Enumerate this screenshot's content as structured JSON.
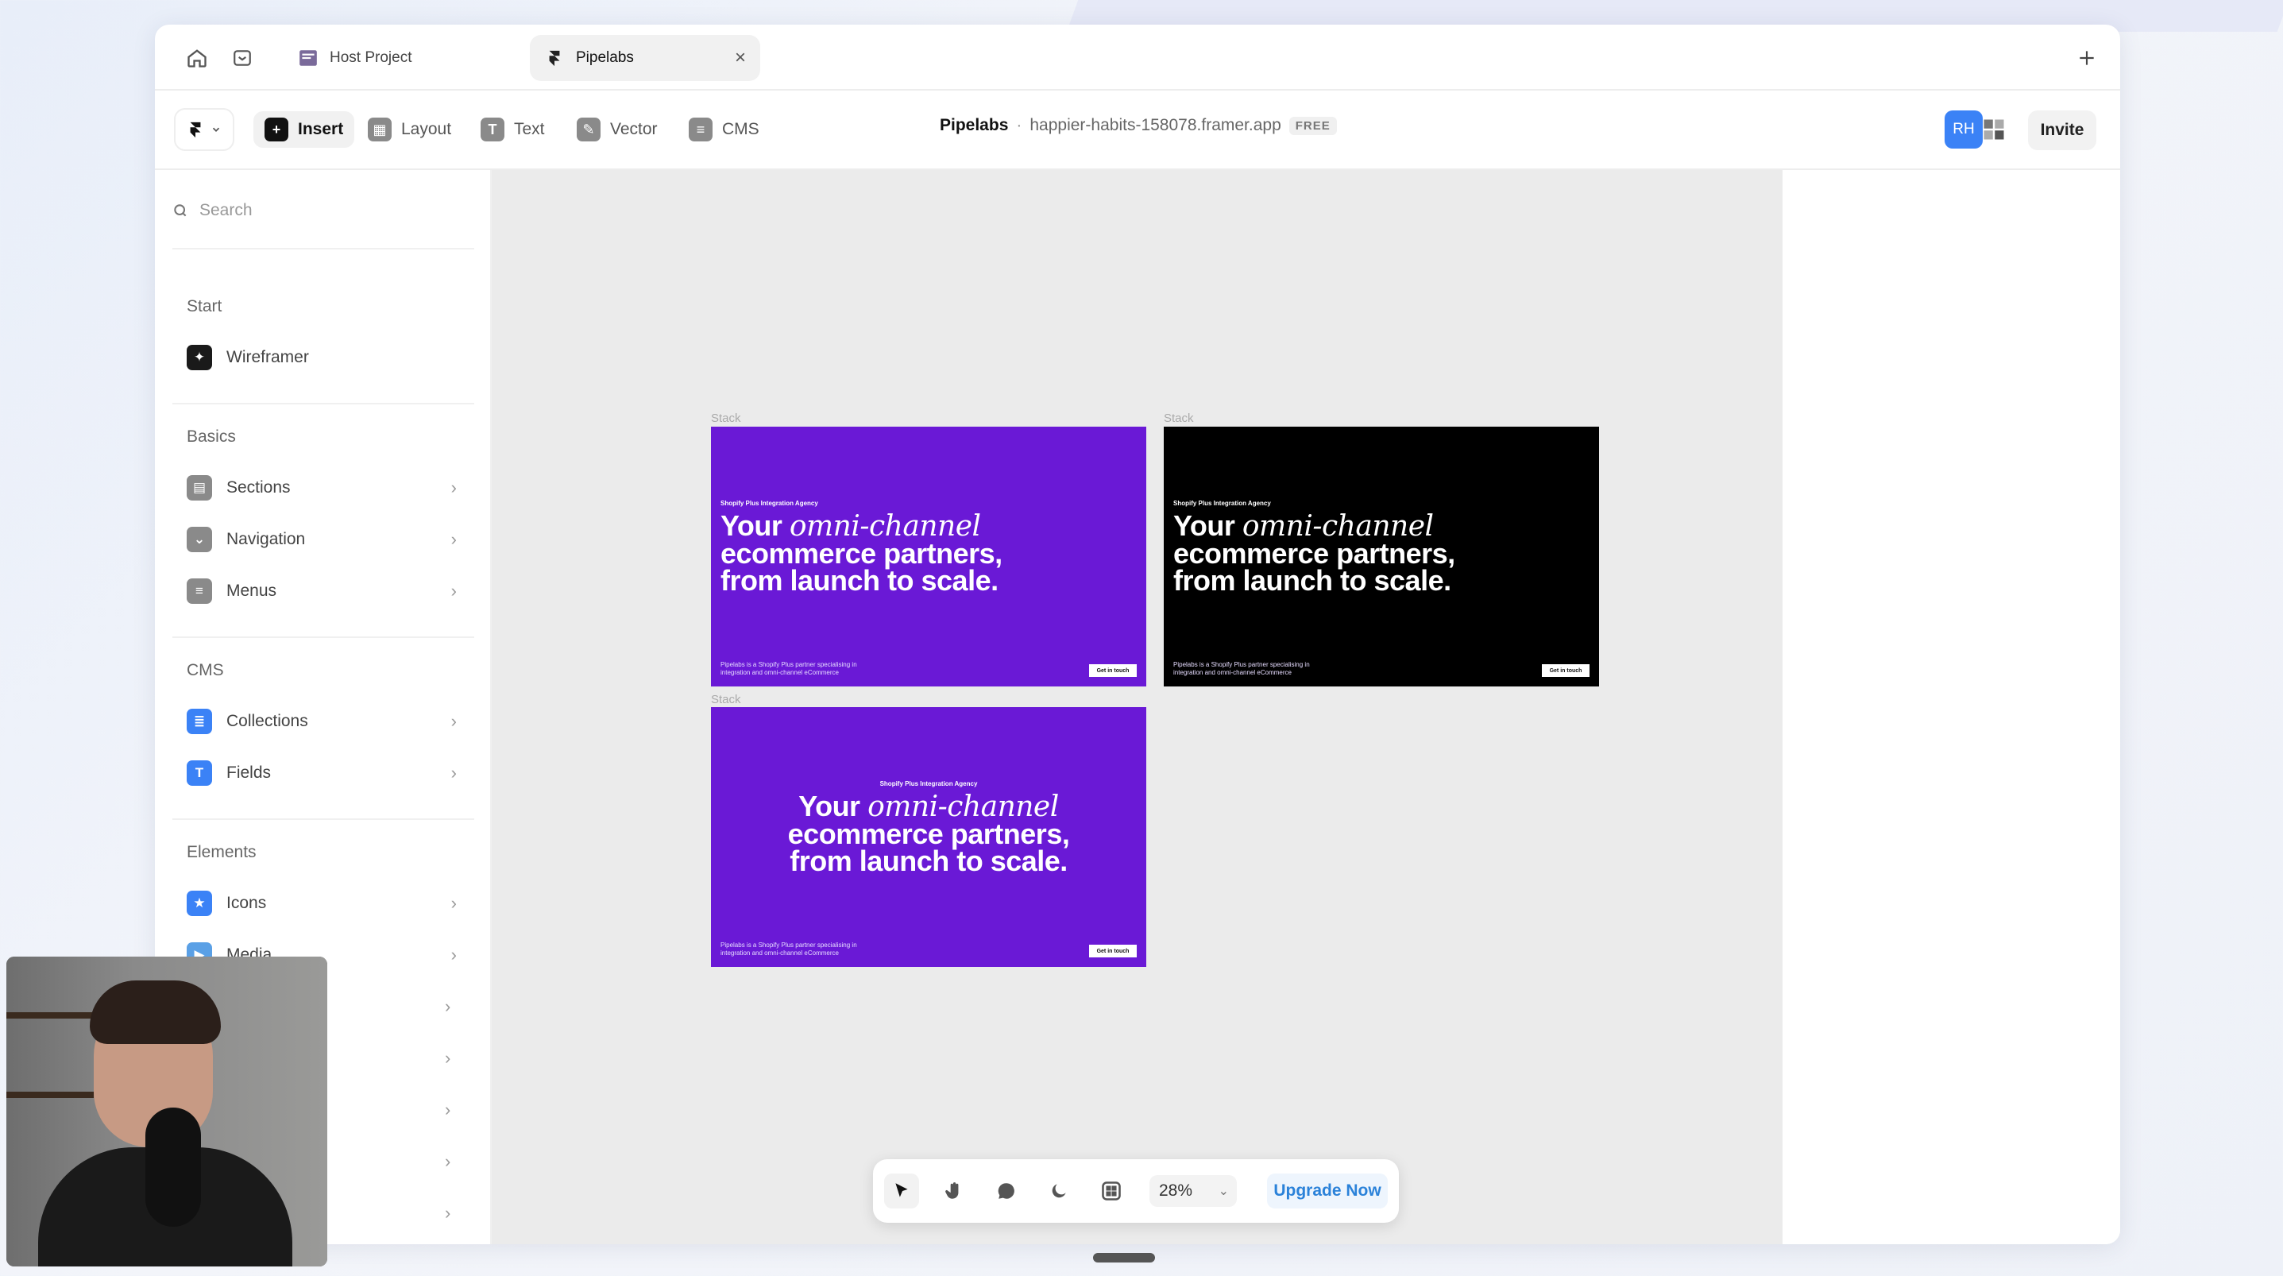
{
  "tabs": [
    {
      "label": "Host Project",
      "active": false
    },
    {
      "label": "Pipelabs",
      "active": true
    }
  ],
  "toolbar": {
    "tools": [
      {
        "label": "Insert",
        "icon": "plus-square-icon",
        "active": true
      },
      {
        "label": "Layout",
        "icon": "layout-icon",
        "active": false
      },
      {
        "label": "Text",
        "icon": "text-icon",
        "active": false
      },
      {
        "label": "Vector",
        "icon": "pen-icon",
        "active": false
      },
      {
        "label": "CMS",
        "icon": "database-icon",
        "active": false
      }
    ],
    "project_name": "Pipelabs",
    "separator": "·",
    "domain": "happier-habits-158078.framer.app",
    "plan_badge": "FREE",
    "avatar_initials": "RH",
    "invite_label": "Invite"
  },
  "sidebar": {
    "search_placeholder": "Search",
    "sections": [
      {
        "heading": "Start",
        "items": [
          {
            "label": "Wireframer",
            "icon": "sparkle-icon",
            "color": "#1a1a1a",
            "chevron": false
          }
        ]
      },
      {
        "heading": "Basics",
        "items": [
          {
            "label": "Sections",
            "icon": "sections-icon",
            "color": "#8a8a8a",
            "chevron": true
          },
          {
            "label": "Navigation",
            "icon": "navigation-icon",
            "color": "#8a8a8a",
            "chevron": true
          },
          {
            "label": "Menus",
            "icon": "menu-icon",
            "color": "#8a8a8a",
            "chevron": true
          }
        ]
      },
      {
        "heading": "CMS",
        "items": [
          {
            "label": "Collections",
            "icon": "collections-icon",
            "color": "#3b82f6",
            "chevron": true
          },
          {
            "label": "Fields",
            "icon": "fields-icon",
            "color": "#3b82f6",
            "chevron": true
          }
        ]
      },
      {
        "heading": "Elements",
        "items": [
          {
            "label": "Icons",
            "icon": "star-icon",
            "color": "#3b82f6",
            "chevron": true
          },
          {
            "label": "Media",
            "icon": "play-icon",
            "color": "#5aa0e6",
            "chevron": true
          }
        ]
      }
    ]
  },
  "canvas": {
    "frames": [
      {
        "label": "Stack",
        "theme": "purple",
        "align": "left"
      },
      {
        "label": "Stack",
        "theme": "black",
        "align": "left"
      },
      {
        "label": "Stack",
        "theme": "purple",
        "align": "center"
      }
    ],
    "hero": {
      "kicker": "Shopify Plus Integration Agency",
      "headline_pre": "Your ",
      "headline_italic": "omni-channel",
      "headline_line2": "ecommerce partners,",
      "headline_line3": "from launch to scale.",
      "footer": "Pipelabs is a Shopify Plus partner specialising in integration and omni-channel eCommerce",
      "cta": "Get in touch"
    },
    "colors": {
      "purple": "#6a19d6",
      "black": "#000000",
      "canvas_bg": "#ebebeb"
    }
  },
  "bottom_toolbar": {
    "tools": [
      "cursor-icon",
      "hand-icon",
      "comment-icon",
      "moon-icon",
      "grid-icon"
    ],
    "zoom": "28%",
    "upgrade_label": "Upgrade Now"
  }
}
